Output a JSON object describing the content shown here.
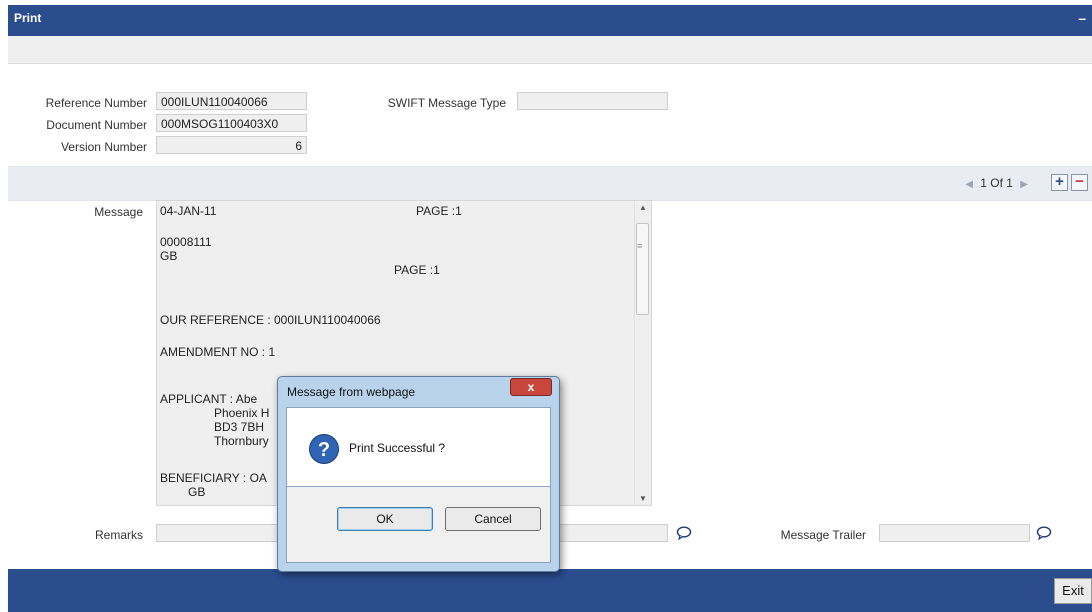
{
  "window": {
    "title": "Print",
    "minimize_label": "–"
  },
  "form": {
    "reference_number_label": "Reference Number",
    "reference_number_value": "000ILUN110040066",
    "document_number_label": "Document Number",
    "document_number_value": "000MSOG1100403X0",
    "version_number_label": "Version Number",
    "version_number_value": "6",
    "swift_message_type_label": "SWIFT Message Type",
    "swift_message_type_value": ""
  },
  "pager": {
    "text": "1 Of 1",
    "prev_icon": "◀",
    "next_icon": "▶",
    "add_label": "+",
    "remove_label": "−"
  },
  "message": {
    "label": "Message",
    "lines": {
      "date": "04-JAN-11",
      "page1": "PAGE :1",
      "code": "00008111",
      "country1": "GB",
      "page2": "PAGE :1",
      "our_reference": "OUR REFERENCE : 000ILUN110040066",
      "amendment": "AMENDMENT NO : 1",
      "applicant": "APPLICANT   : Abe",
      "addr1": "Phoenix H",
      "addr2": "BD3 7BH",
      "addr3": "Thornbury",
      "beneficiary": "BENEFICIARY : OA",
      "country2": "GB"
    }
  },
  "remarks": {
    "label": "Remarks",
    "value": ""
  },
  "message_trailer": {
    "label": "Message Trailer",
    "value": ""
  },
  "footer": {
    "exit_label": "Exit"
  },
  "dialog": {
    "title": "Message from webpage",
    "close_label": "x",
    "icon": "question-icon",
    "icon_glyph": "?",
    "text": "Print Successful ?",
    "ok_label": "OK",
    "cancel_label": "Cancel"
  },
  "colors": {
    "header_blue": "#2b4d8e",
    "dialog_frame": "#b9d3ec",
    "close_red": "#c9463d"
  }
}
